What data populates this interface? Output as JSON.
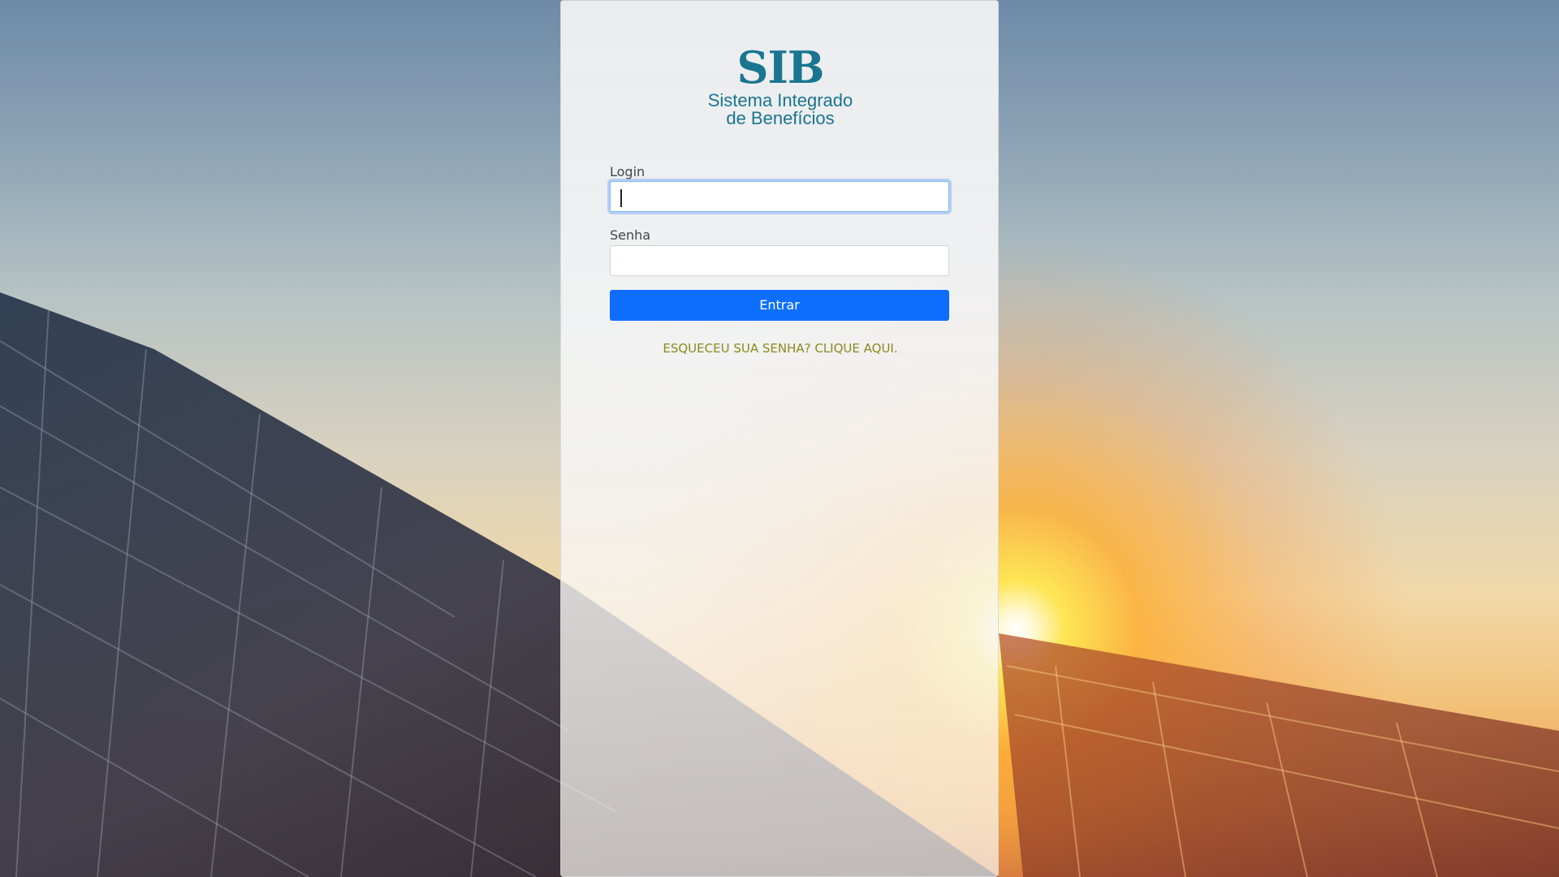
{
  "logo": {
    "mark": "SIB",
    "line1": "Sistema Integrado",
    "line2": "de Benefícios"
  },
  "form": {
    "login_label": "Login",
    "login_value": "",
    "password_label": "Senha",
    "password_value": "",
    "submit_label": "Entrar",
    "forgot_link": "ESQUECEU SUA SENHA? CLIQUE AQUI."
  },
  "colors": {
    "brand": "#1a7590",
    "primary_button": "#0d6efd",
    "link": "#8a8a1f"
  }
}
